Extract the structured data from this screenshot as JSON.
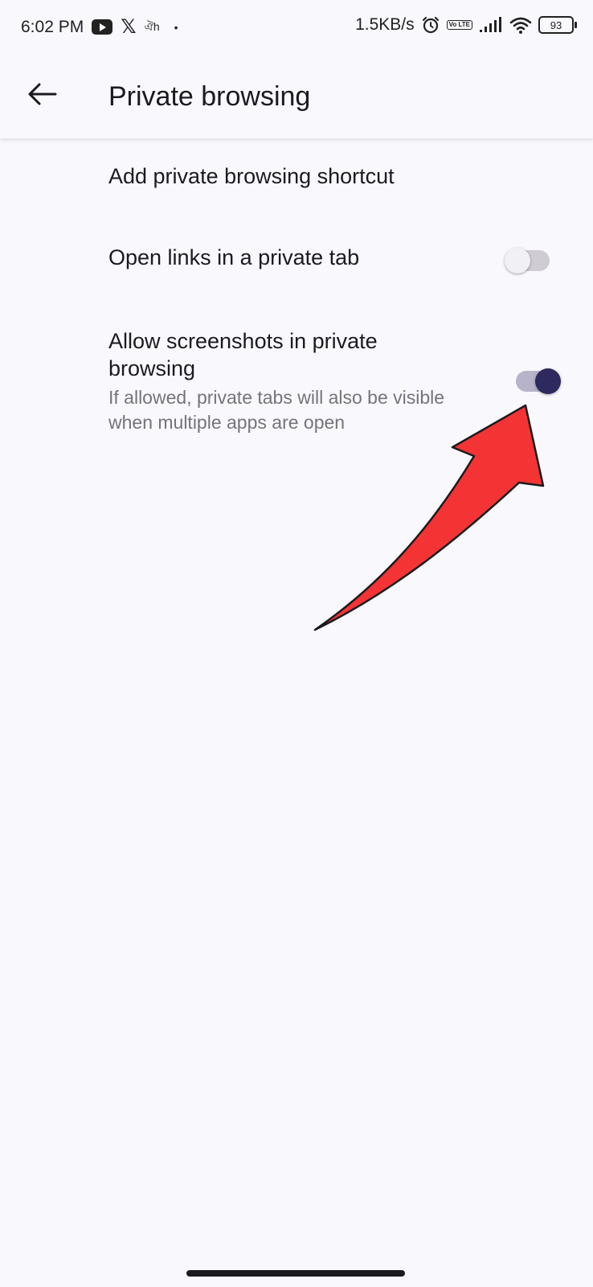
{
  "status_bar": {
    "time": "6:02 PM",
    "notif_icons": [
      "youtube-icon",
      "x-icon",
      "app-icon"
    ],
    "x_glyph": "𝕏",
    "app_glyph": "ঐh",
    "dot": "•",
    "net_speed": "1.5KB/s",
    "volte_label": "Vo LTE",
    "battery": "93"
  },
  "app_bar": {
    "title": "Private browsing"
  },
  "settings": {
    "add_shortcut": {
      "label": "Add private browsing shortcut"
    },
    "open_links": {
      "label": "Open links in a private tab",
      "enabled": false
    },
    "allow_screenshots": {
      "label": "Allow screenshots in private browsing",
      "description": "If allowed, private tabs will also be visible when multiple apps are open",
      "enabled": true
    }
  },
  "colors": {
    "background": "#f9f8fc",
    "switch_on_thumb": "#2e295e",
    "switch_on_track": "#b7b3c9",
    "switch_off_track": "#cfcdd3",
    "annotation_arrow": "#f43434"
  }
}
